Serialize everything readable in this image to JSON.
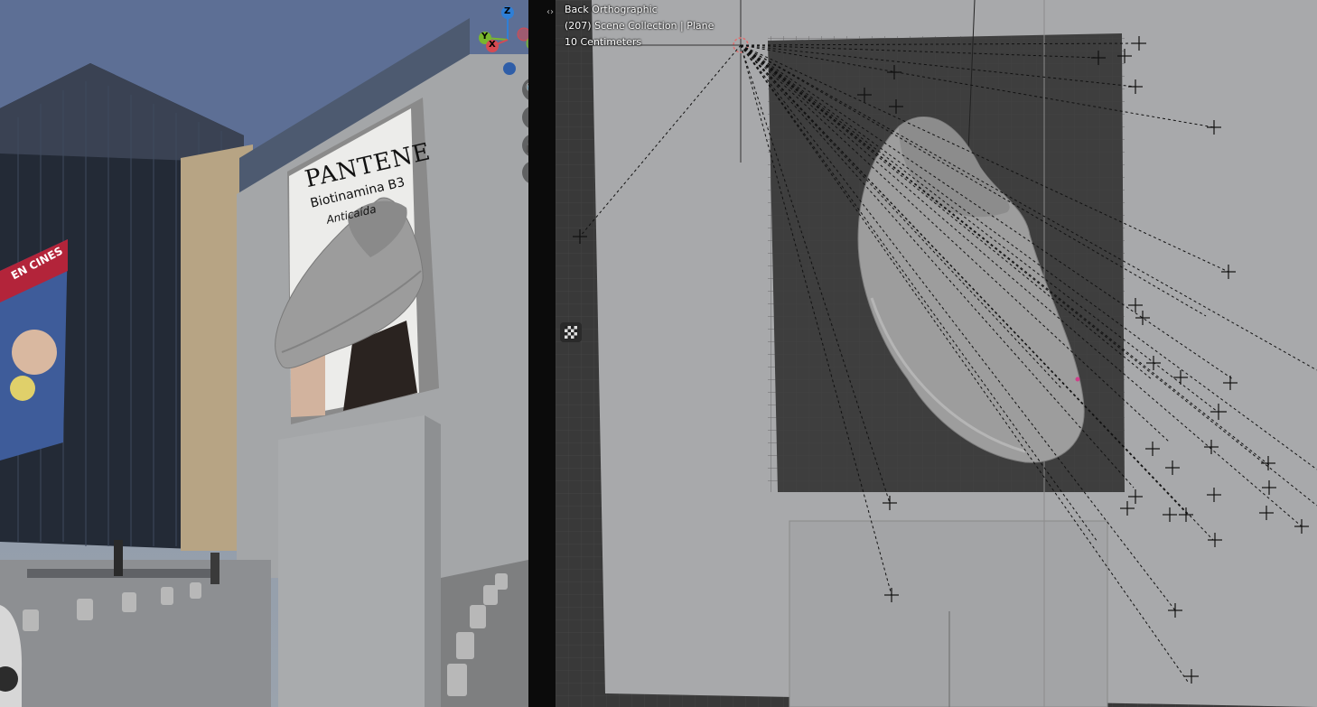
{
  "left_viewport": {
    "billboard": {
      "brand": "PANTENE",
      "line2": "Biotinamina B3",
      "line3": "Anticaída"
    },
    "building_banner": "EN CINES",
    "gizmo": {
      "z_label": "Z",
      "y_label": "Y",
      "x_label": "X",
      "colors": {
        "z": "#2f7fd6",
        "y": "#78b62e",
        "x": "#d64a52",
        "neg": "#2f5ea8"
      }
    },
    "nav_tools": [
      {
        "name": "zoom-icon",
        "glyph": "🔍"
      },
      {
        "name": "pan-icon",
        "glyph": "✋"
      },
      {
        "name": "camera-icon",
        "glyph": "🎥"
      },
      {
        "name": "lock-icon",
        "glyph": "🔓"
      }
    ]
  },
  "splitter": {
    "collapse_glyph": "‹›"
  },
  "right_viewport": {
    "view_name": "Back Orthographic",
    "collection_info": "(207) Scene Collection | Plane",
    "scale": "10 Centimeters",
    "sidebar_toggle_icon": "checker-icon"
  },
  "colors": {
    "grid_bg": "#393939",
    "plane_light": "#a9a9a9",
    "shoe": "#9a9a9a",
    "tracker": "#111111"
  }
}
